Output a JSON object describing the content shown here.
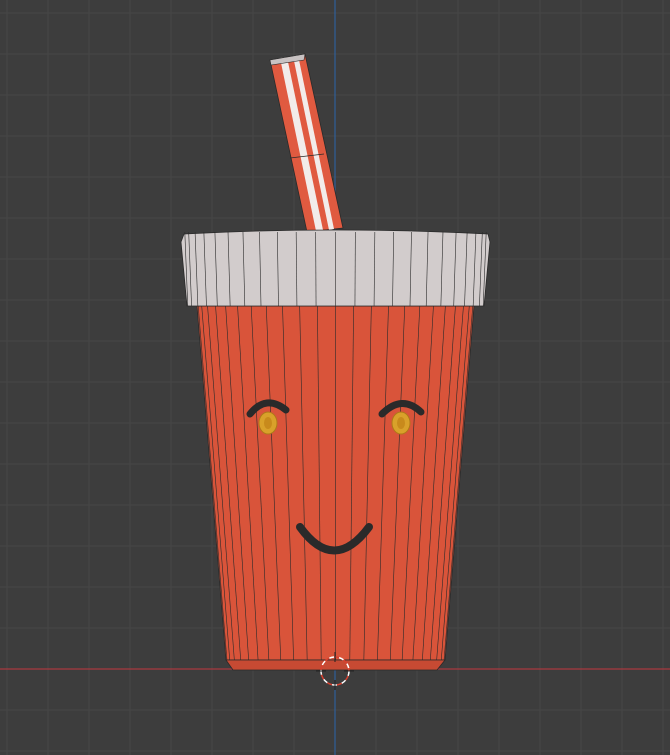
{
  "viewport": {
    "background": "#3d3d3d",
    "grid_color": "#474747",
    "x_axis_color": "#a8383f",
    "y_axis_color": "#2f5f9a"
  },
  "model": {
    "cup_color": "#d9543a",
    "lid_color": "#d2cccc",
    "straw_color": "#e05a40",
    "eye_color": "#d9a12a",
    "feature_color": "#2a2a2a"
  }
}
